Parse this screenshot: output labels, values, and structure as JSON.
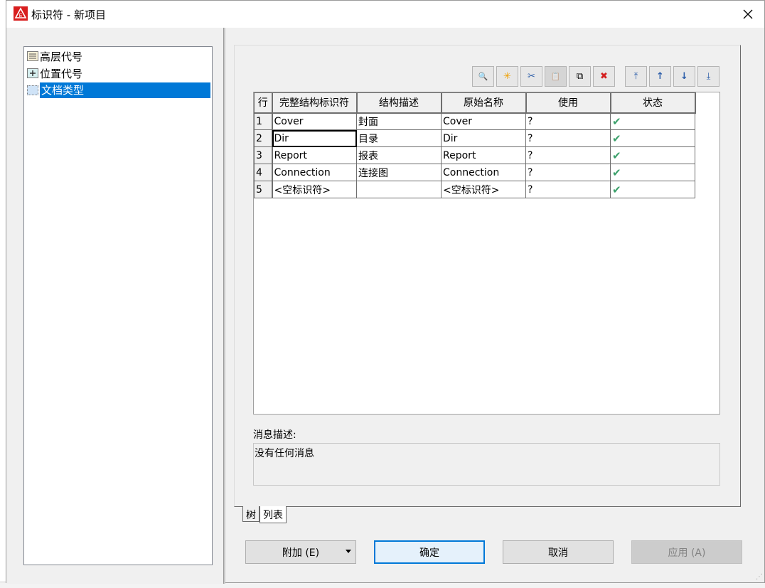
{
  "window": {
    "title": "标识符 - 新项目"
  },
  "tree": {
    "items": [
      {
        "label": "高层代号",
        "icon": "list-icon"
      },
      {
        "label": "位置代号",
        "icon": "plus-box-icon"
      },
      {
        "label": "文档类型",
        "icon": "dotted-box-icon",
        "selected": true
      }
    ]
  },
  "toolbar": {
    "buttons": [
      {
        "name": "find",
        "glyph": "🔍"
      },
      {
        "name": "new",
        "glyph": "✳"
      },
      {
        "name": "cut",
        "glyph": "✂"
      },
      {
        "name": "paste",
        "glyph": "📋",
        "disabled": true
      },
      {
        "name": "copy",
        "glyph": "⧉"
      },
      {
        "name": "delete",
        "glyph": "✖"
      }
    ],
    "move_buttons": [
      {
        "name": "move-top",
        "glyph": "⤒"
      },
      {
        "name": "move-up",
        "glyph": "↑"
      },
      {
        "name": "move-down",
        "glyph": "↓"
      },
      {
        "name": "move-bottom",
        "glyph": "⤓"
      }
    ]
  },
  "table": {
    "headers": [
      "行",
      "完整结构标识符",
      "结构描述",
      "原始名称",
      "使用",
      "状态"
    ],
    "rows": [
      {
        "row": "1",
        "id": "Cover",
        "desc": "封面",
        "orig": "Cover",
        "use": "?",
        "status": "✔"
      },
      {
        "row": "2",
        "id": "Dir",
        "desc": "目录",
        "orig": "Dir",
        "use": "?",
        "status": "✔"
      },
      {
        "row": "3",
        "id": "Report",
        "desc": "报表",
        "orig": "Report",
        "use": "?",
        "status": "✔"
      },
      {
        "row": "4",
        "id": "Connection",
        "desc": "连接图",
        "orig": "Connection",
        "use": "?",
        "status": "✔"
      },
      {
        "row": "5",
        "id": "<空标识符>",
        "desc": "",
        "orig": "<空标识符>",
        "use": "?",
        "status": "✔"
      }
    ]
  },
  "message": {
    "label": "消息描述:",
    "text": "没有任何消息"
  },
  "tabs": [
    "树",
    "列表"
  ],
  "buttons": {
    "add": "附加 (E)",
    "ok": "确定",
    "cancel": "取消",
    "apply": "应用 (A)"
  },
  "colors": {
    "selection": "#0078d7",
    "check": "#3aa06a",
    "delete": "#d42020",
    "new": "#f0a000"
  }
}
